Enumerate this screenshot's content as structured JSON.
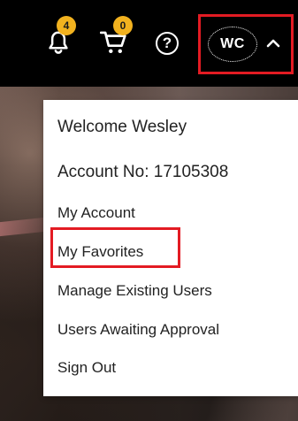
{
  "header": {
    "notifications": {
      "icon": "bell-icon",
      "count": "4"
    },
    "cart": {
      "icon": "cart-icon",
      "count": "0"
    },
    "help": {
      "icon": "help-icon",
      "label": "?"
    },
    "user": {
      "initials": "WC",
      "icon": "chevron-up-icon"
    }
  },
  "account_menu": {
    "welcome": "Welcome Wesley",
    "account_no": "Account No: 17105308",
    "items": [
      {
        "label": "My Account"
      },
      {
        "label": "My Favorites"
      },
      {
        "label": "Manage Existing Users"
      },
      {
        "label": "Users Awaiting Approval"
      },
      {
        "label": "Sign Out"
      }
    ]
  },
  "colors": {
    "badge": "#f2b21f",
    "highlight": "#e31b23",
    "topbar": "#000000"
  }
}
